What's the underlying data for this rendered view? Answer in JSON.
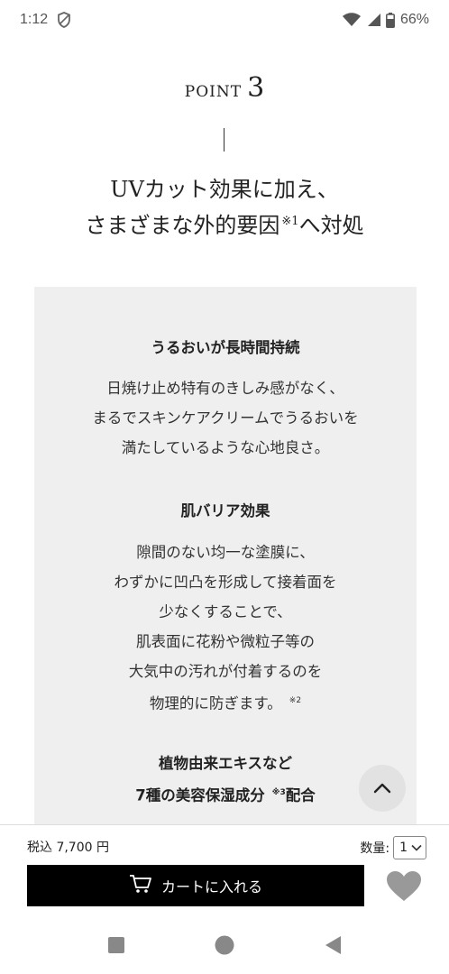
{
  "status_bar": {
    "time": "1:12",
    "battery": "66%"
  },
  "point": {
    "label": "POINT",
    "number": "3"
  },
  "heading": {
    "line1": "UVカット効果に加え、",
    "line2_before": "さまざまな外的要因",
    "line2_note": "※1",
    "line2_after": "へ対処"
  },
  "features": {
    "f1": {
      "title": "うるおいが長時間持続",
      "lines": [
        "日焼け止め特有のきしみ感がなく、",
        "まるでスキンケアクリームでうるおいを",
        "満たしているような心地良さ。"
      ]
    },
    "f2": {
      "title": "肌バリア効果",
      "lines": [
        "隙間のない均一な塗膜に、",
        "わずかに凹凸を形成して接着面を",
        "少なくすることで、",
        "肌表面に花粉や微粒子等の",
        "大気中の汚れが付着するのを",
        "物理的に防ぎます。"
      ],
      "note": "※2"
    },
    "f3": {
      "title_line1": "植物由来エキスなど",
      "title_line2_before": "7種の美容保湿成分",
      "title_line2_note": "※3",
      "title_line2_after": "配合"
    }
  },
  "purchase": {
    "price": "税込 7,700 円",
    "qty_label": "数量:",
    "qty_value": "1",
    "cart_label": "カートに入れる"
  },
  "colors": {
    "box_bg": "#efefef",
    "button_bg": "#000000",
    "heart": "#999999"
  }
}
